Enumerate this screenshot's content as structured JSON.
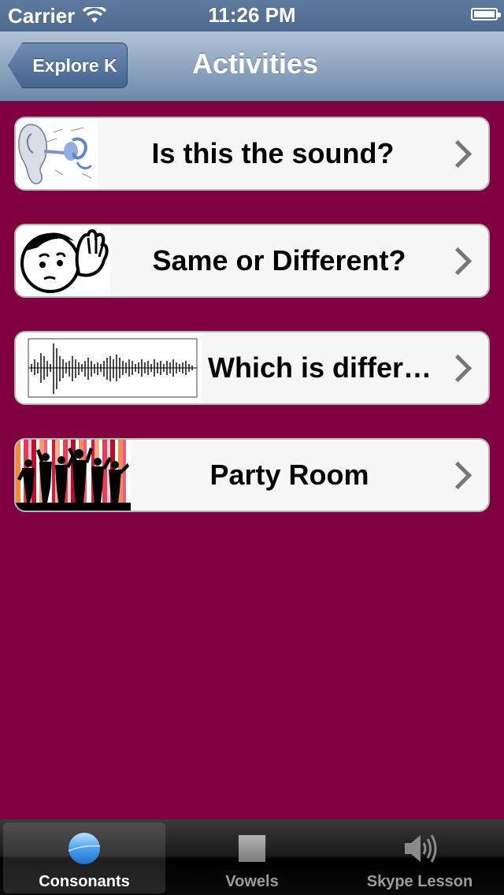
{
  "status_bar": {
    "carrier": "Carrier",
    "time": "11:26 PM"
  },
  "nav": {
    "back_label": "Explore K",
    "title": "Activities"
  },
  "activities": [
    {
      "label": "Is this the sound?",
      "icon": "ear-anatomy-icon"
    },
    {
      "label": "Same or Different?",
      "icon": "listening-face-icon"
    },
    {
      "label": "Which is differe...",
      "icon": "waveform-icon"
    },
    {
      "label": "Party Room",
      "icon": "party-silhouette-icon"
    }
  ],
  "tabs": [
    {
      "label": "Consonants",
      "icon": "blue-circle-icon",
      "selected": true
    },
    {
      "label": "Vowels",
      "icon": "gray-square-icon",
      "selected": false
    },
    {
      "label": "Skype Lesson",
      "icon": "speaker-icon",
      "selected": false
    }
  ],
  "colors": {
    "background": "#7f0040",
    "navbar": "#8ea5c0",
    "tabbar": "#111111",
    "row": "#f7f7f7"
  }
}
